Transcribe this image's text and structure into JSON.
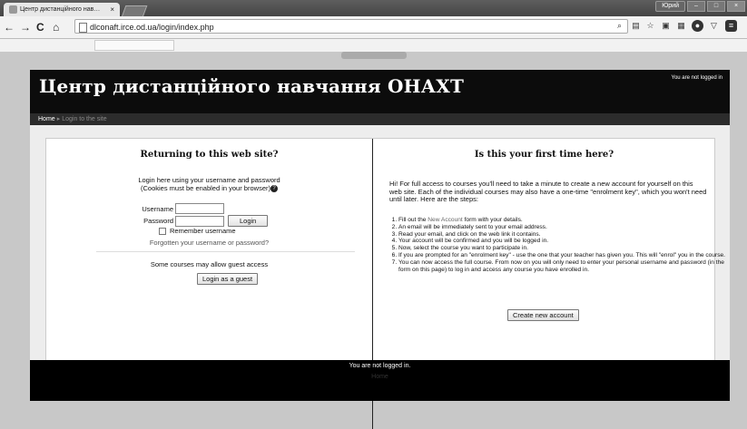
{
  "browser": {
    "tab_title": "Центр дистанційного нав…",
    "user_button": "Юрий",
    "address": "dlconaft.irce.od.ua/login/index.php"
  },
  "site": {
    "title": "Центр дистанційного навчання ОНАХТ",
    "login_info": "You are not logged in",
    "breadcrumb": {
      "home": "Home",
      "current": "Login to the site"
    }
  },
  "login": {
    "heading": "Returning to this web site?",
    "desc_line1": "Login here using your username and password",
    "desc_line2": "(Cookies must be enabled in your browser)",
    "username_label": "Username",
    "password_label": "Password",
    "login_button": "Login",
    "remember_label": "Remember username",
    "forgot_link": "Forgotten your username or password?",
    "guest_text": "Some courses may allow guest access",
    "guest_button": "Login as a guest"
  },
  "signup": {
    "heading": "Is this your first time here?",
    "intro": "Hi! For full access to courses you'll need to take a minute to create a new account for yourself on this web site. Each of the individual courses may also have a one-time \"enrolment key\", which you won't need until later. Here are the steps:",
    "step1_pre": "Fill out the ",
    "step1_link": "New Account",
    "step1_post": " form with your details.",
    "step2": "An email will be immediately sent to your email address.",
    "step3": "Read your email, and click on the web link it contains.",
    "step4": "Your account will be confirmed and you will be logged in.",
    "step5": "Now, select the course you want to participate in.",
    "step6": "If you are prompted for an \"enrolment key\" - use the one that your teacher has given you. This will \"enrol\" you in the course.",
    "step7": "You can now access the full course. From now on you will only need to enter your personal username and password (in the form on this page) to log in and access any course you have enrolled in.",
    "create_button": "Create new account"
  },
  "footer": {
    "login_info": "You are not logged in.",
    "home": "Home"
  }
}
